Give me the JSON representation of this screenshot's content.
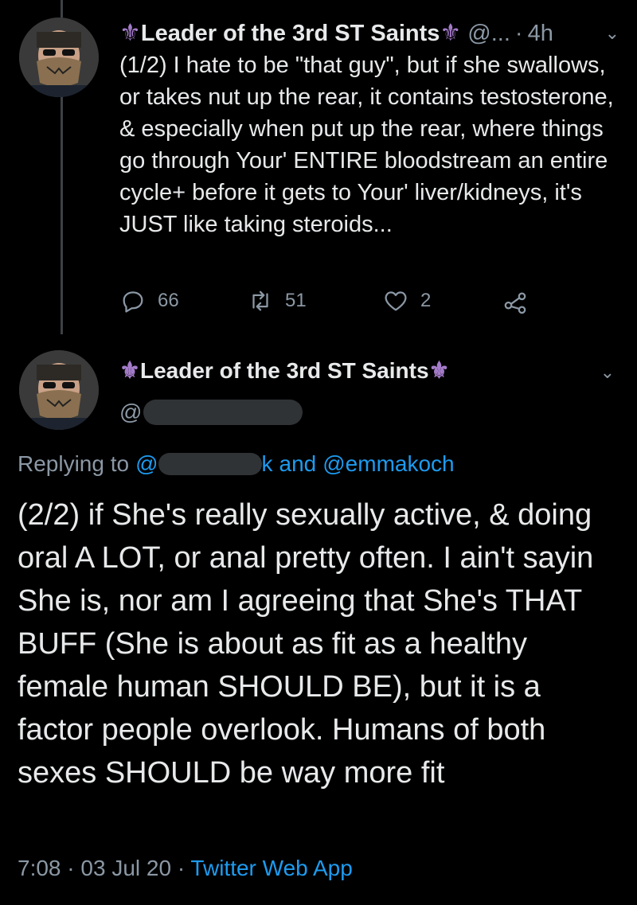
{
  "tweet1": {
    "display_name": "Leader of the 3rd ST Saints",
    "handle": "@...",
    "separator": "·",
    "time": "4h",
    "text": "(1/2) I hate to be \"that guy\", but if she swallows, or takes nut up the rear, it contains testosterone, & especially when put up the rear, where things go through Your' ENTIRE bloodstream an entire cycle+ before it gets to Your' liver/kidneys, it's JUST like taking steroids...",
    "replies": "66",
    "retweets": "51",
    "likes": "2"
  },
  "tweet2": {
    "display_name": "Leader of the 3rd ST Saints",
    "handle_prefix": "@",
    "replying_label": "Replying to",
    "replying_prefix": "@",
    "replying_tail": "k",
    "replying_and": "and",
    "replying_to_2": "@emmakoch",
    "text": "(2/2) if She's really sexually active, & doing oral A LOT, or anal pretty often. I ain't sayin She is, nor am I agreeing that She's THAT BUFF (She is about as fit as a healthy female human SHOULD BE), but it is a factor people overlook. Humans of both sexes SHOULD be way more fit",
    "time": "7:08",
    "sep1": "·",
    "date": "03 Jul 20",
    "sep2": "·",
    "source": "Twitter Web App"
  },
  "icons": {
    "fleur": "⚜",
    "caret": "⌄",
    "reply": "reply-icon",
    "retweet": "retweet-icon",
    "like": "like-icon",
    "share": "share-icon"
  },
  "colors": {
    "background": "#000000",
    "text": "#e7e9ea",
    "muted": "#8b98a5",
    "link": "#1d9bf0",
    "fleur": "#a57ccb"
  }
}
